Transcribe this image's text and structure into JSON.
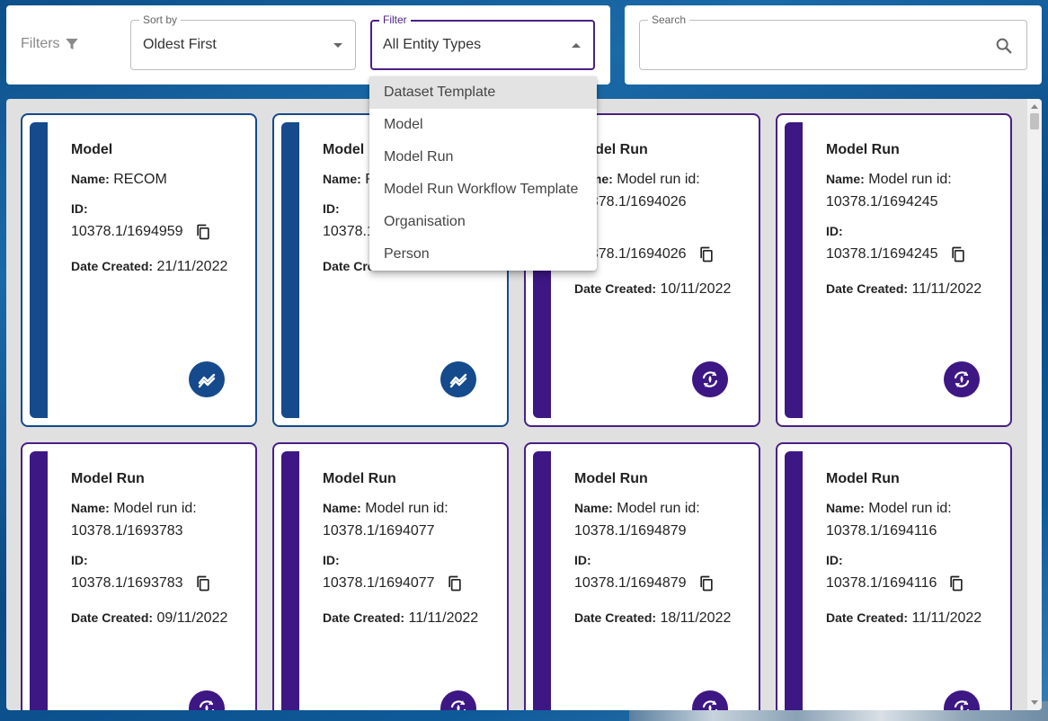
{
  "colors": {
    "model_accent": "#154a8c",
    "run_accent": "#3d1784",
    "focus": "#4a1f86"
  },
  "filters_label": "Filters",
  "sort": {
    "legend": "Sort by",
    "value": "Oldest First"
  },
  "filter": {
    "legend": "Filter",
    "value": "All Entity Types",
    "options": [
      "Dataset Template",
      "Model",
      "Model Run",
      "Model Run Workflow Template",
      "Organisation",
      "Person"
    ]
  },
  "search": {
    "legend": "Search",
    "value": ""
  },
  "labels": {
    "name": "Name:",
    "id": "ID:",
    "date": "Date Created:"
  },
  "cards": [
    {
      "type": "Model",
      "name": "RECOM",
      "id": "10378.1/1694959",
      "date": "21/11/2022",
      "icon": "model-icon"
    },
    {
      "type": "Model",
      "name": "R",
      "id": "10378.1",
      "date": "",
      "icon": "model-icon"
    },
    {
      "type": "Model Run",
      "name": "Model run id: 10378.1/1694026",
      "id": "10378.1/1694026",
      "date": "10/11/2022",
      "icon": "model-run-icon"
    },
    {
      "type": "Model Run",
      "name": "Model run id: 10378.1/1694245",
      "id": "10378.1/1694245",
      "date": "11/11/2022",
      "icon": "model-run-icon"
    },
    {
      "type": "Model Run",
      "name": "Model run id: 10378.1/1693783",
      "id": "10378.1/1693783",
      "date": "09/11/2022",
      "icon": "model-run-icon"
    },
    {
      "type": "Model Run",
      "name": "Model run id: 10378.1/1694077",
      "id": "10378.1/1694077",
      "date": "11/11/2022",
      "icon": "model-run-icon"
    },
    {
      "type": "Model Run",
      "name": "Model run id: 10378.1/1694879",
      "id": "10378.1/1694879",
      "date": "18/11/2022",
      "icon": "model-run-icon"
    },
    {
      "type": "Model Run",
      "name": "Model run id: 10378.1/1694116",
      "id": "10378.1/1694116",
      "date": "11/11/2022",
      "icon": "model-run-icon"
    }
  ]
}
